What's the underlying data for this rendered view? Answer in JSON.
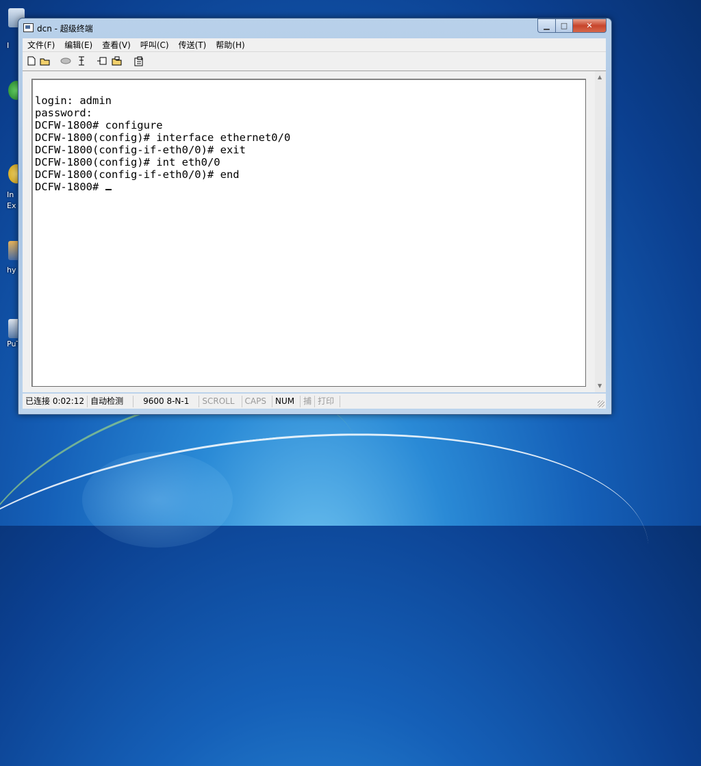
{
  "window": {
    "title": "dcn - 超级终端",
    "controls": {
      "minimize": "▁",
      "maximize": "□",
      "close": "✕"
    }
  },
  "menubar": {
    "items": [
      "文件(F)",
      "编辑(E)",
      "查看(V)",
      "呼叫(C)",
      "传送(T)",
      "帮助(H)"
    ]
  },
  "toolbar": {
    "icons": [
      "new-document-icon",
      "open-folder-icon",
      "phone-disconnect-icon",
      "dial-icon",
      "send-icon",
      "receive-icon",
      "properties-icon"
    ]
  },
  "terminal": {
    "lines": [
      "login: admin",
      "password:",
      "DCFW-1800# configure",
      "DCFW-1800(config)# interface ethernet0/0",
      "DCFW-1800(config-if-eth0/0)# exit",
      "DCFW-1800(config)# int eth0/0",
      "DCFW-1800(config-if-eth0/0)# end"
    ],
    "prompt": "DCFW-1800# "
  },
  "statusbar": {
    "connected": "已连接 0:02:12",
    "detect": "自动检测",
    "params": "9600 8-N-1",
    "scroll": "SCROLL",
    "caps": "CAPS",
    "num": "NUM",
    "capture": "捕",
    "print": "打印"
  },
  "desktop": {
    "labels": [
      "I",
      "In",
      "Ex",
      "hy",
      "PuT"
    ]
  }
}
